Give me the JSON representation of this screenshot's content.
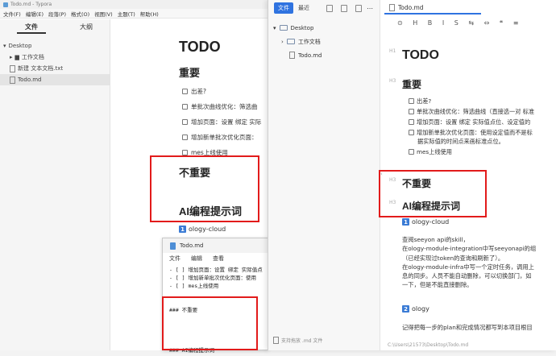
{
  "typora": {
    "window_title": "Todo.md - Typora",
    "menu": [
      "文件(F)",
      "编辑(E)",
      "段落(P)",
      "格式(O)",
      "视图(V)",
      "主题(T)",
      "帮助(H)"
    ],
    "sidebar_tabs": [
      "文件",
      "大纲"
    ],
    "tree": [
      "Desktop",
      "工作文档",
      "新建 文本文档.txt",
      "Todo.md"
    ],
    "doc": {
      "h1": "TODO",
      "h3_important": "重要",
      "tasks": [
        "出差?",
        "单批次曲线优化：筛选曲",
        "增加页面：设置 绑定 实际",
        "增加新单批次优化页面：",
        "mes上线使用"
      ],
      "h3_not_important": "不重要",
      "h3_ai": "AI编程提示词",
      "ology1": "ology-cloud"
    }
  },
  "notepad": {
    "title": "Todo.md",
    "menu": [
      "文件",
      "编辑",
      "查看"
    ],
    "lines": [
      "- [ ] 增加页面：设置 绑定 实际值点",
      "- [ ] 增加新单批次优化页面：使用",
      "- [ ] mes上线使用",
      "",
      "",
      "### 不重要",
      "",
      "",
      "",
      "",
      "### AI编程提示词"
    ]
  },
  "right": {
    "side_tabs": [
      "文件",
      "最近"
    ],
    "tree": [
      "Desktop",
      "工作文档",
      "Todo.md"
    ],
    "footer": "支持拖放 .md 文件",
    "tab_title": "Todo.md",
    "toolbar": "⊙ H B I S ⇆ ⇔ ❝ ≡",
    "h1": "TODO",
    "h3_important": "重要",
    "tasks": [
      [
        "出差?"
      ],
      [
        "单批次曲线优化：筛选曲线（直接选一对 标准"
      ],
      [
        "增加页面：设置 绑定 实际值点位、设定值的"
      ],
      [
        "增加新单批次优化页面：使用设定值而不是标",
        "据实际值的时间点来画标准点位。"
      ],
      [
        "mes上线使用"
      ]
    ],
    "h3_not_important": "不重要",
    "h3_ai": "AI编程提示词",
    "ology1": "ology-cloud",
    "para": [
      "查阅seeyon api的skill，",
      "在ology-module-integration中写seeyonapi的组",
      "（已经实现过token的查询和刷新了）。",
      "在ology-module-infra中写一个定时任务，调用上",
      "息的同步。人员不能自动删除，可以切换部门，如",
      "一下，但是不能直接删除。"
    ],
    "ology2": "ology",
    "last_line": "记得把每一步的plan和完成情况都写到本项目根目",
    "status": "C:\\Users\\21573\\Desktop\\Todo.md",
    "heading_marks": [
      "H1",
      "H3",
      "H3",
      "H3"
    ]
  },
  "colors": {
    "accent": "#2f73e0",
    "highlight_box": "#e21b1b"
  }
}
